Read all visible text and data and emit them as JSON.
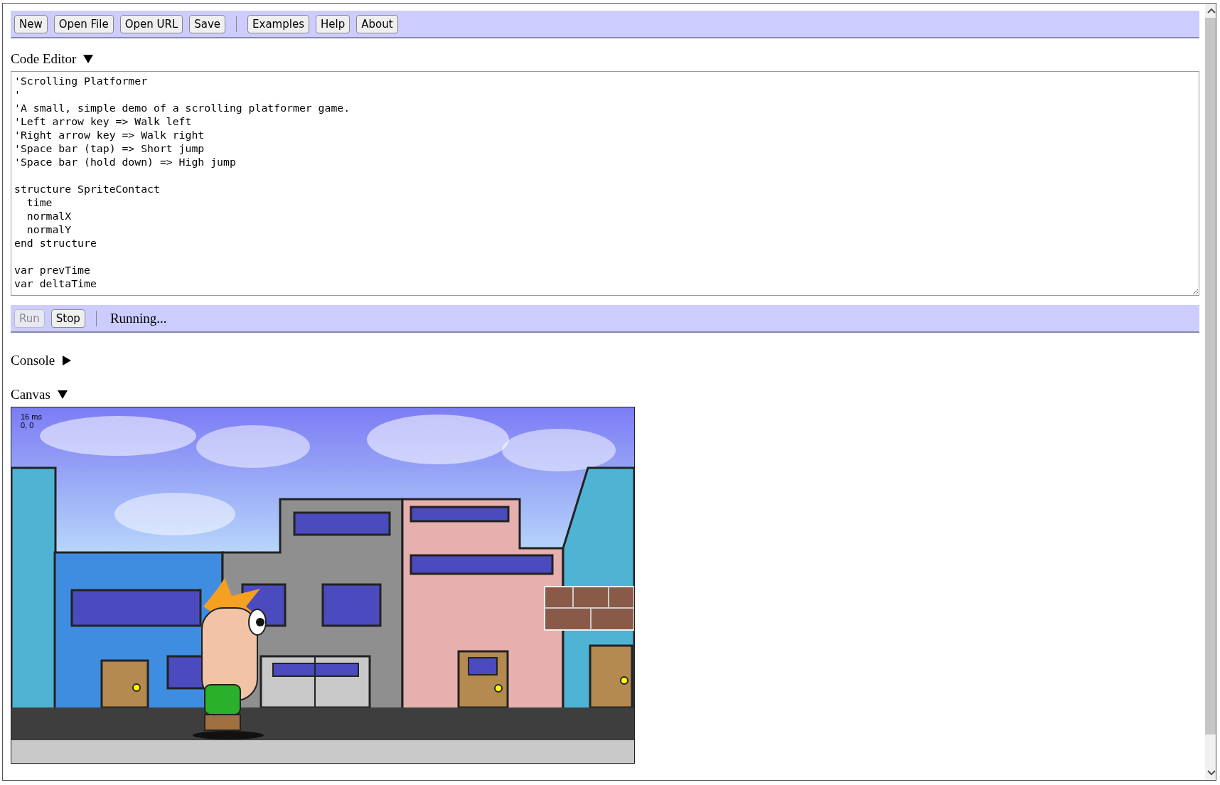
{
  "toolbar": {
    "file_buttons": [
      "New",
      "Open File",
      "Open URL",
      "Save"
    ],
    "info_buttons": [
      "Examples",
      "Help",
      "About"
    ]
  },
  "code_editor": {
    "heading": "Code Editor",
    "expanded": true,
    "line_blocks": [
      [
        "'Scrolling Platformer",
        "'",
        "'A small, simple demo of a scrolling platformer game.",
        "'Left arrow key => Walk left",
        "'Right arrow key => Walk right",
        "'Space bar (tap) => Short jump",
        "'Space bar (hold down) => High jump"
      ],
      [
        "structure SpriteContact",
        "  time",
        "  normalX",
        "  normalY",
        "end structure"
      ],
      [
        "var prevTime",
        "var deltaTime"
      ]
    ]
  },
  "run_bar": {
    "buttons": [
      {
        "label": "Run",
        "disabled": true
      },
      {
        "label": "Stop",
        "disabled": false
      }
    ],
    "status": "Running..."
  },
  "console": {
    "heading": "Console",
    "expanded": false
  },
  "canvas": {
    "heading": "Canvas",
    "expanded": true,
    "overlay_lines": [
      "16 ms",
      "0, 0"
    ]
  }
}
